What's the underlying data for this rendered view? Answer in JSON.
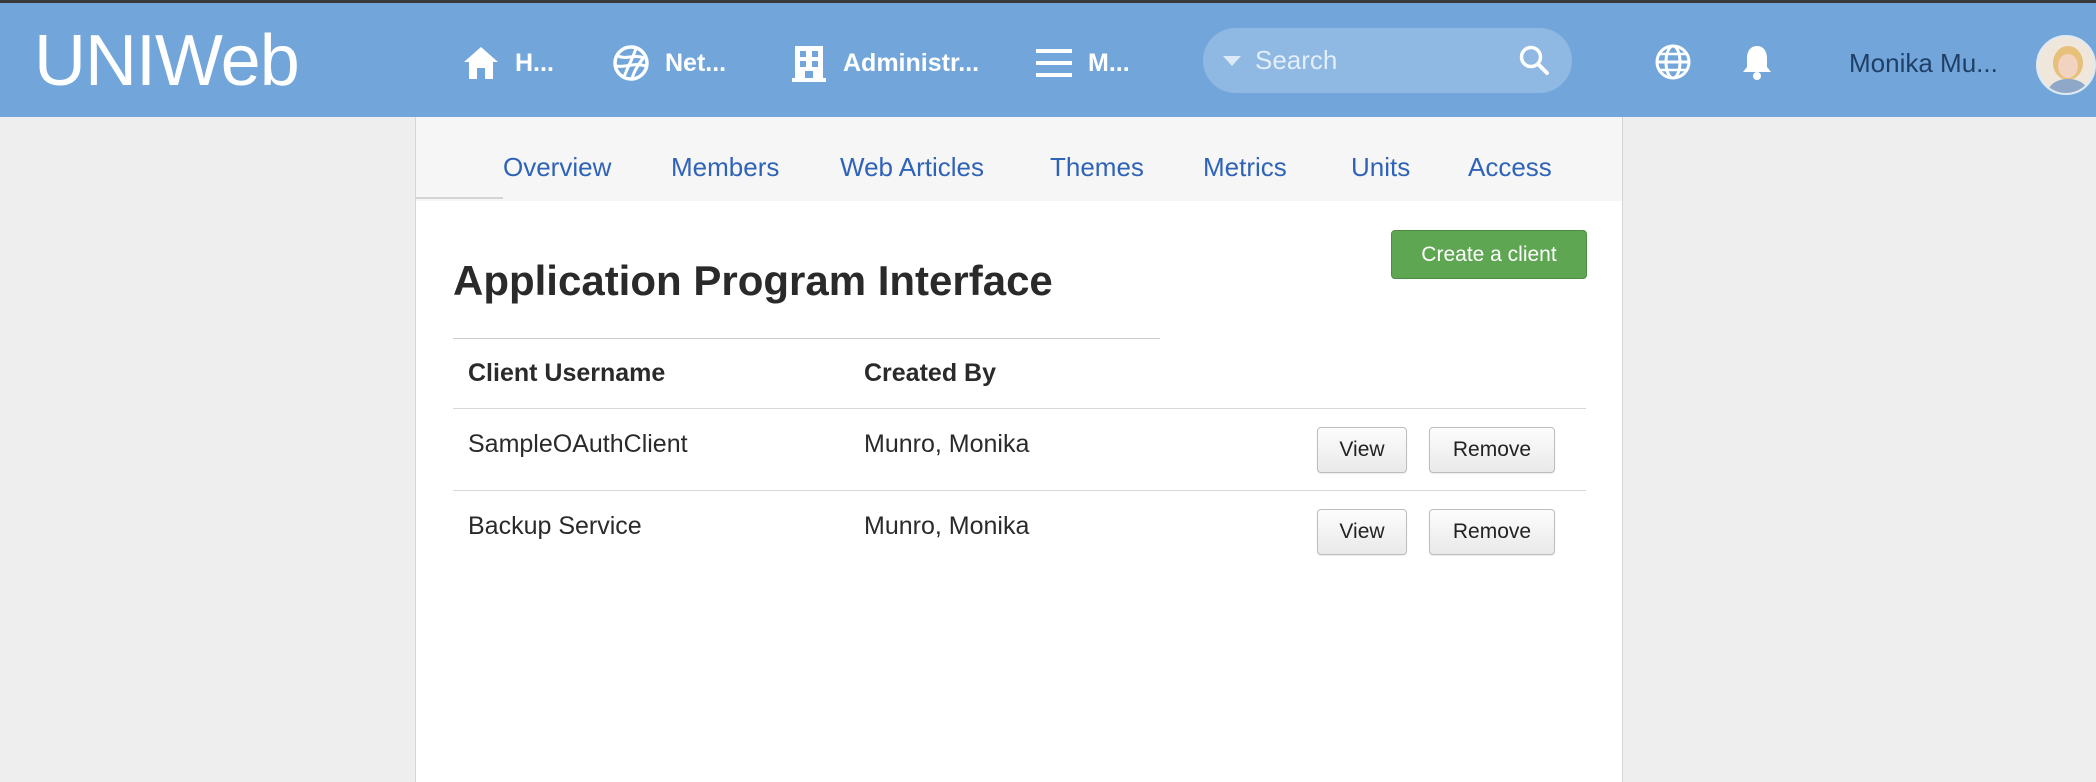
{
  "app": {
    "logo": "UNIWeb"
  },
  "nav": {
    "items": [
      {
        "label": "H...",
        "icon": "home-icon"
      },
      {
        "label": "Net...",
        "icon": "network-icon"
      },
      {
        "label": "Administr...",
        "icon": "building-icon"
      },
      {
        "label": "M...",
        "icon": "menu-icon"
      }
    ],
    "search_placeholder": "Search",
    "user_name": "Monika Mu..."
  },
  "tabs": [
    "Overview",
    "Members",
    "Web Articles",
    "Themes",
    "Metrics",
    "Units",
    "Access"
  ],
  "main": {
    "title": "Application Program Interface",
    "create_button": "Create a client",
    "columns": [
      "Client Username",
      "Created By"
    ],
    "rows": [
      {
        "username": "SampleOAuthClient",
        "created_by": "Munro, Monika",
        "view": "View",
        "remove": "Remove"
      },
      {
        "username": "Backup Service",
        "created_by": "Munro, Monika",
        "view": "View",
        "remove": "Remove"
      }
    ]
  },
  "colors": {
    "topbar": "#72a6da",
    "accent_link": "#2f63b8",
    "create_button": "#5ea651"
  }
}
